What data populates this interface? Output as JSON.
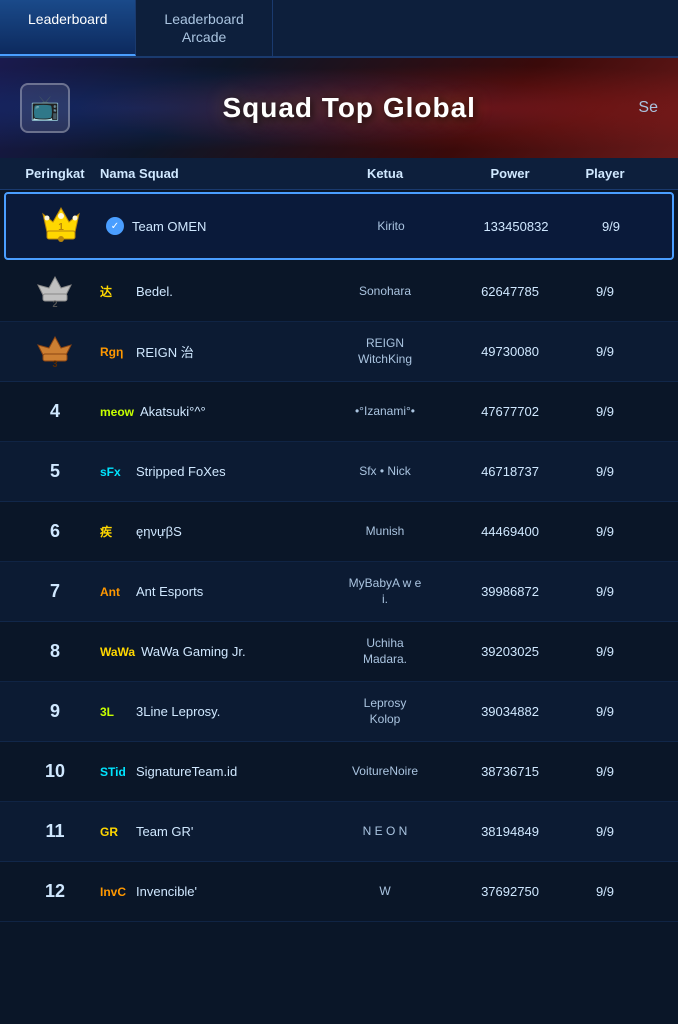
{
  "tabs": [
    {
      "id": "leaderboard",
      "label": "Leaderboard",
      "active": true
    },
    {
      "id": "leaderboard-arcade",
      "label": "Leaderboard\nArcade",
      "active": false
    }
  ],
  "banner": {
    "icon": "📺",
    "title": "Squad Top Global",
    "search_label": "Se..."
  },
  "columns": {
    "peringkat": "Peringkat",
    "nama_squad": "Nama Squad",
    "ketua": "Ketua",
    "power": "Power",
    "player": "Player"
  },
  "squads": [
    {
      "rank": 1,
      "rank_type": "gold_crown",
      "tag": "",
      "tag_color": "gold",
      "name": "Team OMEN",
      "verified": true,
      "ketua": "Kirito",
      "power": "133450832",
      "player": "9/9",
      "row_class": "rank1"
    },
    {
      "rank": 2,
      "rank_type": "silver_crown",
      "tag": "达",
      "tag_color": "gold",
      "name": "Bedel.",
      "verified": false,
      "ketua": "Sonohara",
      "power": "62647785",
      "player": "9/9",
      "row_class": "normal"
    },
    {
      "rank": 3,
      "rank_type": "bronze_crown",
      "tag": "Rgη",
      "tag_color": "orange",
      "name": "REIGN 治",
      "verified": false,
      "ketua": "REIGN\nWitchKing",
      "power": "49730080",
      "player": "9/9",
      "row_class": "alt"
    },
    {
      "rank": 4,
      "rank_type": "number",
      "tag": "meow",
      "tag_color": "lime",
      "name": "Akatsuki°^°",
      "verified": false,
      "ketua": "•°Izanami°•",
      "power": "47677702",
      "player": "9/9",
      "row_class": "normal"
    },
    {
      "rank": 5,
      "rank_type": "number",
      "tag": "sFx",
      "tag_color": "cyan",
      "name": "Stripped FoXes",
      "verified": false,
      "ketua": "Sfx • Nick",
      "power": "46718737",
      "player": "9/9",
      "row_class": "alt"
    },
    {
      "rank": 6,
      "rank_type": "number",
      "tag": "疾",
      "tag_color": "gold",
      "name": "ęηνựβS",
      "verified": false,
      "ketua": "Munish",
      "power": "44469400",
      "player": "9/9",
      "row_class": "normal"
    },
    {
      "rank": 7,
      "rank_type": "number",
      "tag": "Ant",
      "tag_color": "orange",
      "name": "Ant Esports",
      "verified": false,
      "ketua": "MyBabyA w e\ni.",
      "power": "39986872",
      "player": "9/9",
      "row_class": "alt"
    },
    {
      "rank": 8,
      "rank_type": "number",
      "tag": "WaWa",
      "tag_color": "gold",
      "name": "WaWa Gaming Jr.",
      "verified": false,
      "ketua": "Uchiha\nMadara.",
      "power": "39203025",
      "player": "9/9",
      "row_class": "normal"
    },
    {
      "rank": 9,
      "rank_type": "number",
      "tag": "3L",
      "tag_color": "lime",
      "name": "3Line Leprosy.",
      "verified": false,
      "ketua": "Leprosy\nKolop",
      "power": "39034882",
      "player": "9/9",
      "row_class": "alt"
    },
    {
      "rank": 10,
      "rank_type": "number",
      "tag": "STid",
      "tag_color": "cyan",
      "name": "SignatureTeam.id",
      "verified": false,
      "ketua": "VoitureNoire",
      "power": "38736715",
      "player": "9/9",
      "row_class": "normal"
    },
    {
      "rank": 11,
      "rank_type": "number",
      "tag": "GR",
      "tag_color": "gold",
      "name": "Team GR'",
      "verified": false,
      "ketua": "N E O N",
      "power": "38194849",
      "player": "9/9",
      "row_class": "alt"
    },
    {
      "rank": 12,
      "rank_type": "number",
      "tag": "InvC",
      "tag_color": "orange",
      "name": "Invencible'",
      "verified": false,
      "ketua": "W",
      "power": "37692750",
      "player": "9/9",
      "row_class": "normal"
    }
  ]
}
